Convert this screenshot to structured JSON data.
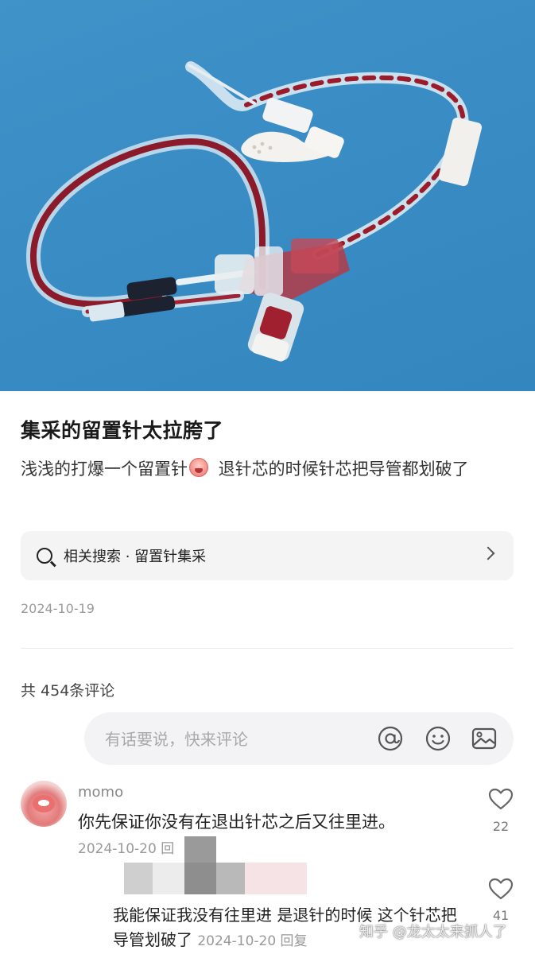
{
  "post": {
    "title": "集采的留置针太拉胯了",
    "body_part1": "浅浅的打爆一个留置针",
    "body_part2": " 退针芯的时候针芯把导管都划破了",
    "related_search": "相关搜索 · 留置针集采",
    "date": "2024-10-19"
  },
  "comments_section": {
    "count_label": "共 454条评论",
    "input_placeholder": "有话要说，快来评论"
  },
  "comments": [
    {
      "username": "momo",
      "text": "你先保证你没有在退出针芯之后又往里进。",
      "meta": "2024-10-20 回",
      "likes": "22"
    },
    {
      "text": "我能保证我没有往里进  是退针的时候 这个针芯把导管划破了",
      "meta": "2024-10-20 回复",
      "likes": "41"
    }
  ],
  "watermark": "知乎 @龙太太来抓人了",
  "icons": {
    "search": "search-icon",
    "chevron": "chevron-right-icon",
    "at": "at-icon",
    "emoji": "emoji-icon",
    "image": "image-icon",
    "like": "heart-icon"
  },
  "colors": {
    "photo_background": "#3a8cc4",
    "blood": "#9b1b2a",
    "muted_text": "#999999"
  }
}
